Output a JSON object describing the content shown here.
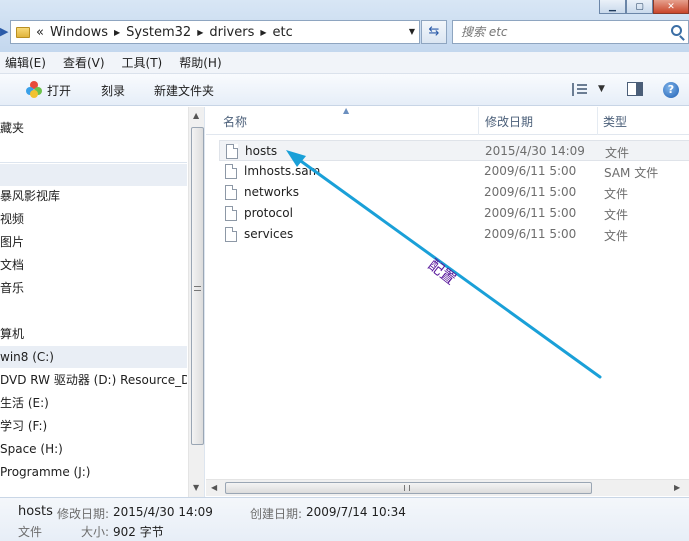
{
  "address": {
    "chevrons": "«",
    "crumbs": [
      "Windows",
      "System32",
      "drivers",
      "etc"
    ]
  },
  "search": {
    "placeholder": "搜索 etc"
  },
  "menubar": {
    "items": [
      "编辑(E)",
      "查看(V)",
      "工具(T)",
      "帮助(H)"
    ]
  },
  "toolbar": {
    "open": "打开",
    "burn": "刻录",
    "new_folder": "新建文件夹",
    "help": "?"
  },
  "navpane": {
    "items": [
      {
        "label": "藏夹",
        "selected": false
      },
      {
        "label": "",
        "selected": true
      },
      {
        "label": "暴风影视库",
        "selected": false
      },
      {
        "label": "视频",
        "selected": false
      },
      {
        "label": "图片",
        "selected": false
      },
      {
        "label": "文档",
        "selected": false
      },
      {
        "label": "音乐",
        "selected": false
      },
      {
        "label": "算机",
        "selected": false
      },
      {
        "label": "win8 (C:)",
        "selected": true
      },
      {
        "label": "DVD RW 驱动器 (D:) Resource_DV",
        "selected": false
      },
      {
        "label": "生活 (E:)",
        "selected": false
      },
      {
        "label": "学习  (F:)",
        "selected": false
      },
      {
        "label": "Space (H:)",
        "selected": false
      },
      {
        "label": "Programme (J:)",
        "selected": false
      }
    ]
  },
  "columns": {
    "name": "名称",
    "date": "修改日期",
    "type": "类型"
  },
  "files": [
    {
      "name": "hosts",
      "date": "2015/4/30 14:09",
      "type": "文件",
      "selected": true
    },
    {
      "name": "lmhosts.sam",
      "date": "2009/6/11 5:00",
      "type": "SAM 文件",
      "selected": false
    },
    {
      "name": "networks",
      "date": "2009/6/11 5:00",
      "type": "文件",
      "selected": false
    },
    {
      "name": "protocol",
      "date": "2009/6/11 5:00",
      "type": "文件",
      "selected": false
    },
    {
      "name": "services",
      "date": "2009/6/11 5:00",
      "type": "文件",
      "selected": false
    }
  ],
  "annotation": {
    "text": "配置",
    "color": "#1aa0d8",
    "text_color": "#5a1a9c"
  },
  "details": {
    "name": "hosts",
    "type": "文件",
    "modified_label": "修改日期:",
    "modified": "2015/4/30 14:09",
    "created_label": "创建日期:",
    "created": "2009/7/14 10:34",
    "size_label": "大小:",
    "size": "902 字节"
  }
}
